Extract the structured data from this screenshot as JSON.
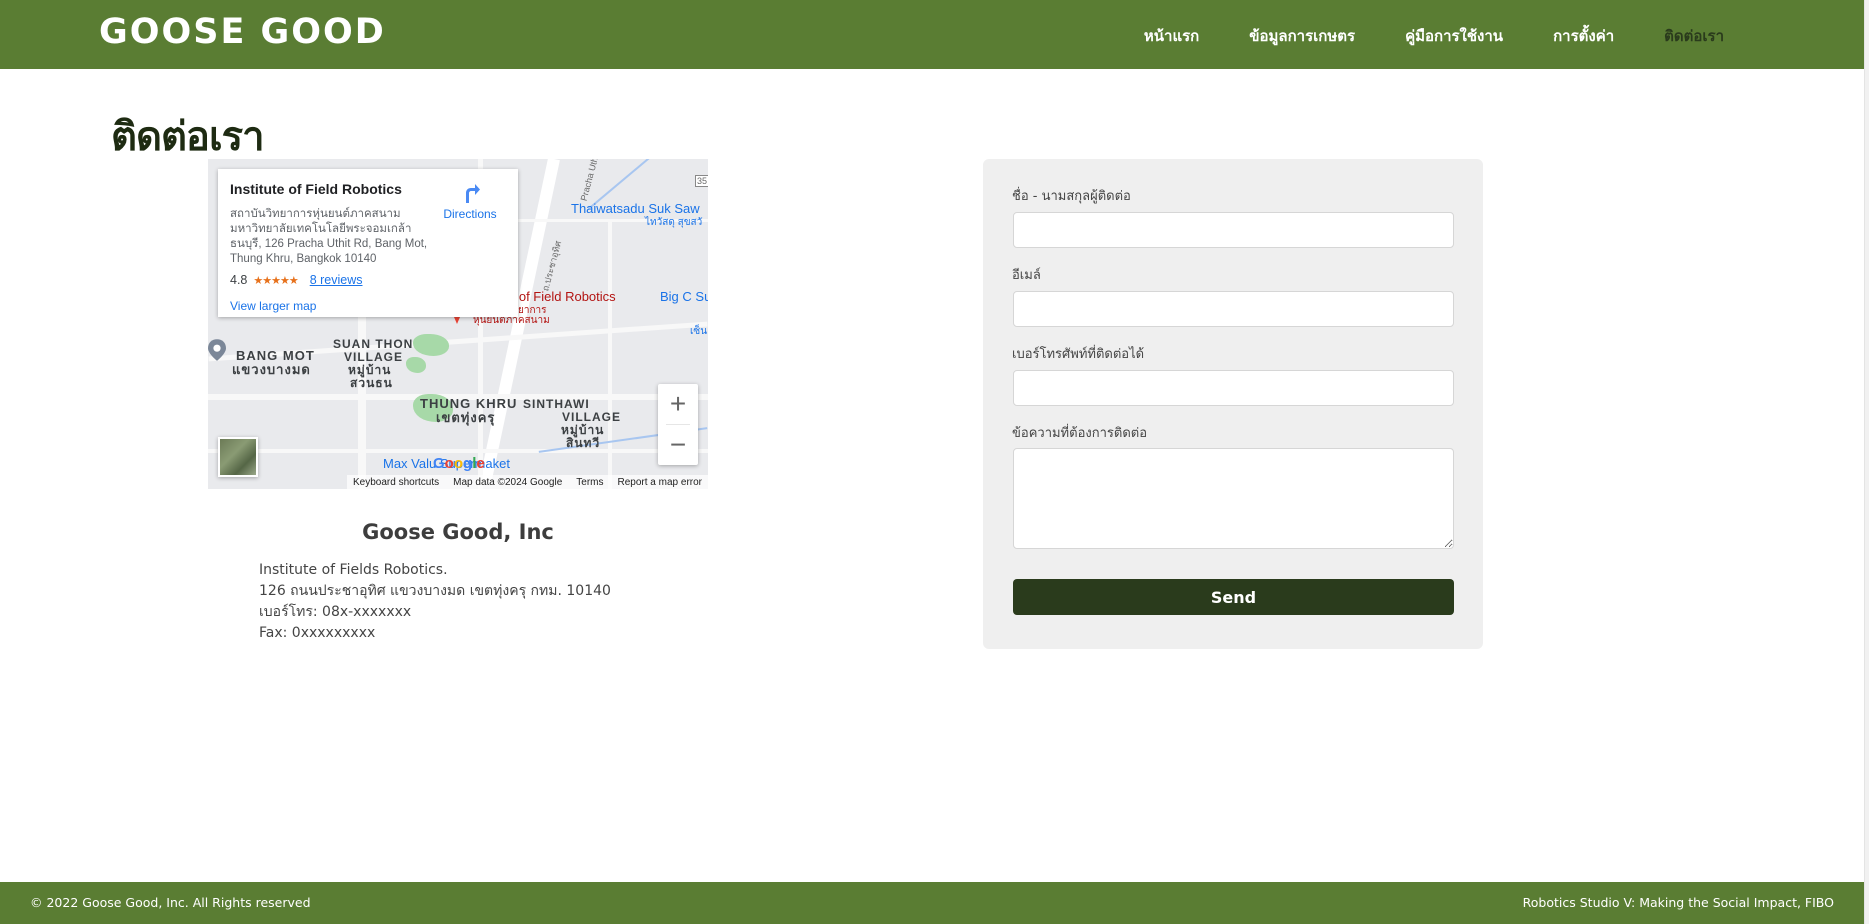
{
  "header": {
    "brand": "GOOSE GOOD",
    "nav": [
      {
        "label": "หน้าแรก"
      },
      {
        "label": "ข้อมูลการเกษตร"
      },
      {
        "label": "คู่มือการใช้งาน"
      },
      {
        "label": "การตั้งค่า"
      },
      {
        "label": "ติดต่อเรา"
      }
    ],
    "active_nav": "ติดต่อเรา"
  },
  "page": {
    "title": "ติดต่อเรา"
  },
  "map": {
    "place_name": "Institute of Field Robotics",
    "address_lines": [
      "สถาบันวิทยาการหุ่นยนต์ภาคสนาม",
      "มหาวิทยาลัยเทคโนโลยีพระจอมเกล้า",
      "ธนบุรี, 126 Pracha Uthit Rd, Bang Mot,",
      "Thung Khru, Bangkok 10140"
    ],
    "rating": "4.8",
    "stars": "★★★★★",
    "reviews": "8 reviews",
    "directions_label": "Directions",
    "view_larger": "View larger map",
    "labels": {
      "thaiwatsadu": "Thaiwatsadu Suk Saw",
      "thaiwatsadu_th": "ไทวัสดุ สุขสวั",
      "ifr": "e of Field Robotics",
      "ifr_th": "ยาการ",
      "ifr_th2": "หุ่นยนต์ภาคสนาม",
      "bigc": "Big C Su",
      "bangmot": "BANG MOT",
      "bangmot_th": "แขวงบางมด",
      "suanthon": "SUAN THON",
      "suanthon2": "VILLAGE",
      "suanthon_th": "หมู่บ้าน",
      "suanthon_th2": "สวนธน",
      "thungkhru": "THUNG KHRU",
      "thungkhru_th": "เขตทุ่งครุ",
      "sinthawi": "SINTHAWI",
      "sinthawi2": "VILLAGE",
      "sinthawi_th": "หมู่บ้าน",
      "sinthawi_th2": "สินทวี",
      "maxvalu": "Max Valu Supermaket",
      "pracha_uthit": "Pracha Uthi",
      "pracha_uthit_th": "ถ.ประชาอุทิศ",
      "road_35": "35",
      "edge_sen": "เซ็น"
    },
    "zoom_in": "+",
    "zoom_out": "−",
    "google": "Google",
    "attribution": [
      "Keyboard shortcuts",
      "Map data ©2024 Google",
      "Terms",
      "Report a map error"
    ]
  },
  "company": {
    "name": "Goose Good, Inc",
    "lines": [
      "Institute of Fields Robotics.",
      "126 ถนนประชาอุทิศ แขวงบางมด เขตทุ่งครุ กทม. 10140",
      "เบอร์โทร: 08x-xxxxxxx",
      "Fax: 0xxxxxxxxx"
    ]
  },
  "form": {
    "name_label": "ชื่อ - นามสกุลผู้ติดต่อ",
    "email_label": "อีเมล์",
    "phone_label": "เบอร์โทรศัพท์ที่ติดต่อได้",
    "message_label": "ข้อความที่ต้องการติดต่อ",
    "name_value": "",
    "email_value": "",
    "phone_value": "",
    "message_value": "",
    "send_label": "Send"
  },
  "footer": {
    "left": "© 2022 Goose Good, Inc. All Rights reserved",
    "right": "Robotics Studio V: Making the Social Impact, FIBO"
  },
  "colors": {
    "brand_green": "#5a7d33",
    "dark_green": "#2a3b1c",
    "form_bg": "#efefef"
  }
}
